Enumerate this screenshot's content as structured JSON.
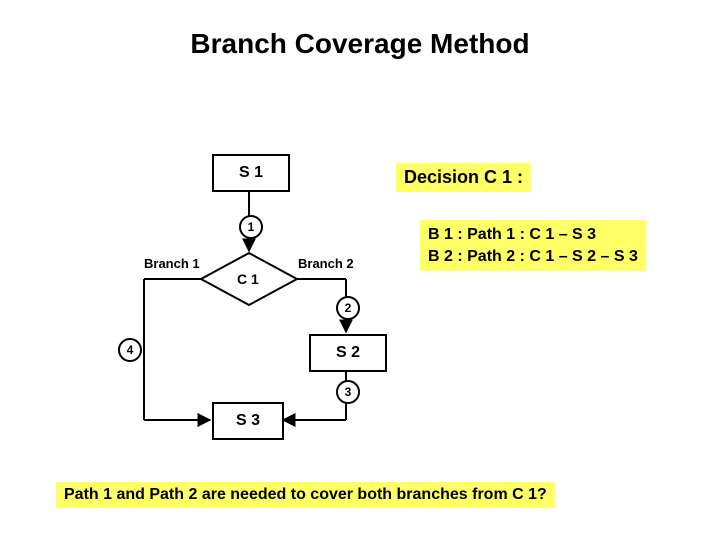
{
  "title": "Branch Coverage Method",
  "nodes": {
    "s1": "S 1",
    "c1": "C 1",
    "s2": "S 2",
    "s3": "S 3"
  },
  "badges": {
    "n1": "1",
    "n2": "2",
    "n3": "3",
    "n4": "4"
  },
  "labels": {
    "branch1": "Branch 1",
    "branch2": "Branch 2"
  },
  "decision": {
    "heading": "Decision C 1 :",
    "line1": "B 1 : Path 1 : C 1 – S 3",
    "line2": "B 2 : Path 2 : C 1 – S 2 – S 3"
  },
  "footer": "Path 1 and Path 2 are needed to cover both branches from C 1?"
}
